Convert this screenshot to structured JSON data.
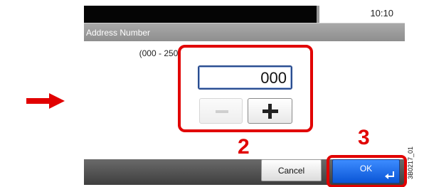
{
  "status_bar": {
    "time": "10:10"
  },
  "title_bar": {
    "title": "Address Number"
  },
  "address_input": {
    "range_label": "(000 - 250)",
    "value": "000"
  },
  "buttons": {
    "minus_label": "—",
    "plus_label": "+",
    "cancel_label": "Cancel",
    "ok_label": "OK"
  },
  "annotations": {
    "step_2": "2",
    "step_3": "3",
    "figure_code": "3B0217_01",
    "highlight_color": "#e10000"
  },
  "colors": {
    "ok_button": "#1a6be8",
    "title_bar": "#9b9b9b",
    "status_bar": "#050505"
  }
}
